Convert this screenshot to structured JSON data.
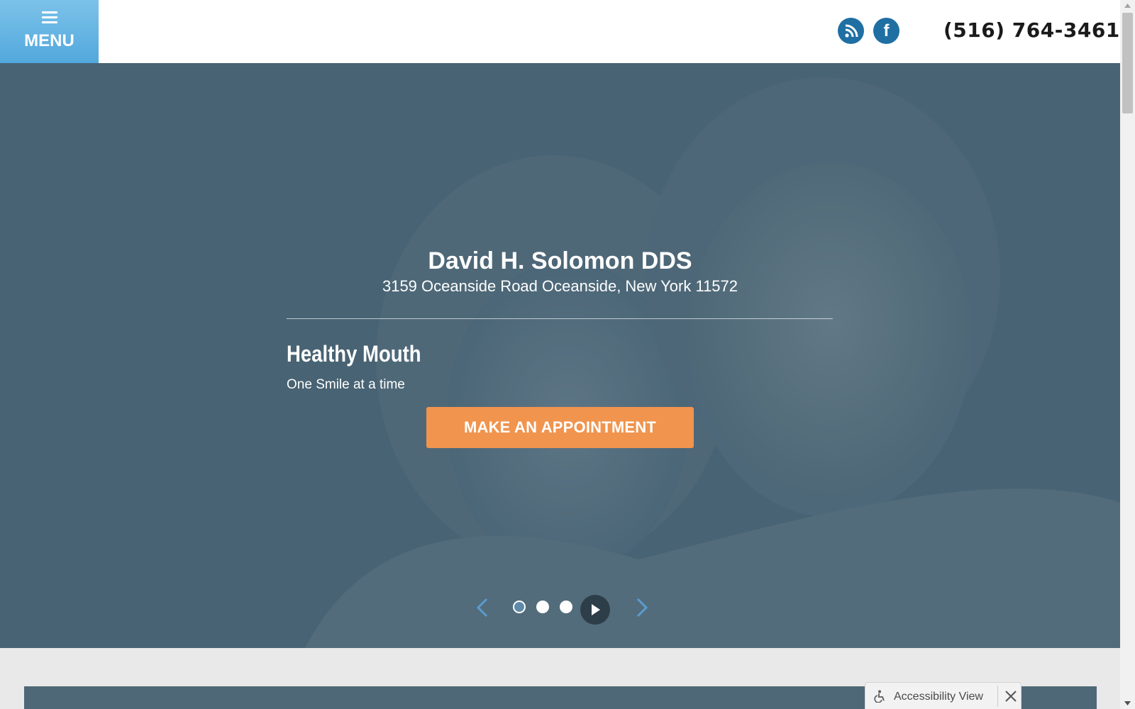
{
  "header": {
    "menu_label": "MENU",
    "phone": "(516) 764-3461",
    "social": [
      {
        "name": "rss-icon"
      },
      {
        "name": "facebook-icon",
        "glyph": "f"
      }
    ]
  },
  "hero": {
    "practice_name": "David H. Solomon DDS",
    "address": "3159 Oceanside Road Oceanside, New York 11572",
    "tagline_title": "Healthy Mouth",
    "tagline_sub": "One Smile at a time",
    "cta_label": "MAKE AN APPOINTMENT",
    "carousel": {
      "slides": 3,
      "active_slide": 1
    }
  },
  "accessibility_widget": {
    "label": "Accessibility View"
  },
  "colors": {
    "menu_bg": "#5aaee0",
    "social_bg": "#1f6fa3",
    "hero_overlay": "#4f6878",
    "cta_bg": "#f0944e",
    "lower_bg": "#e9e9e9"
  }
}
